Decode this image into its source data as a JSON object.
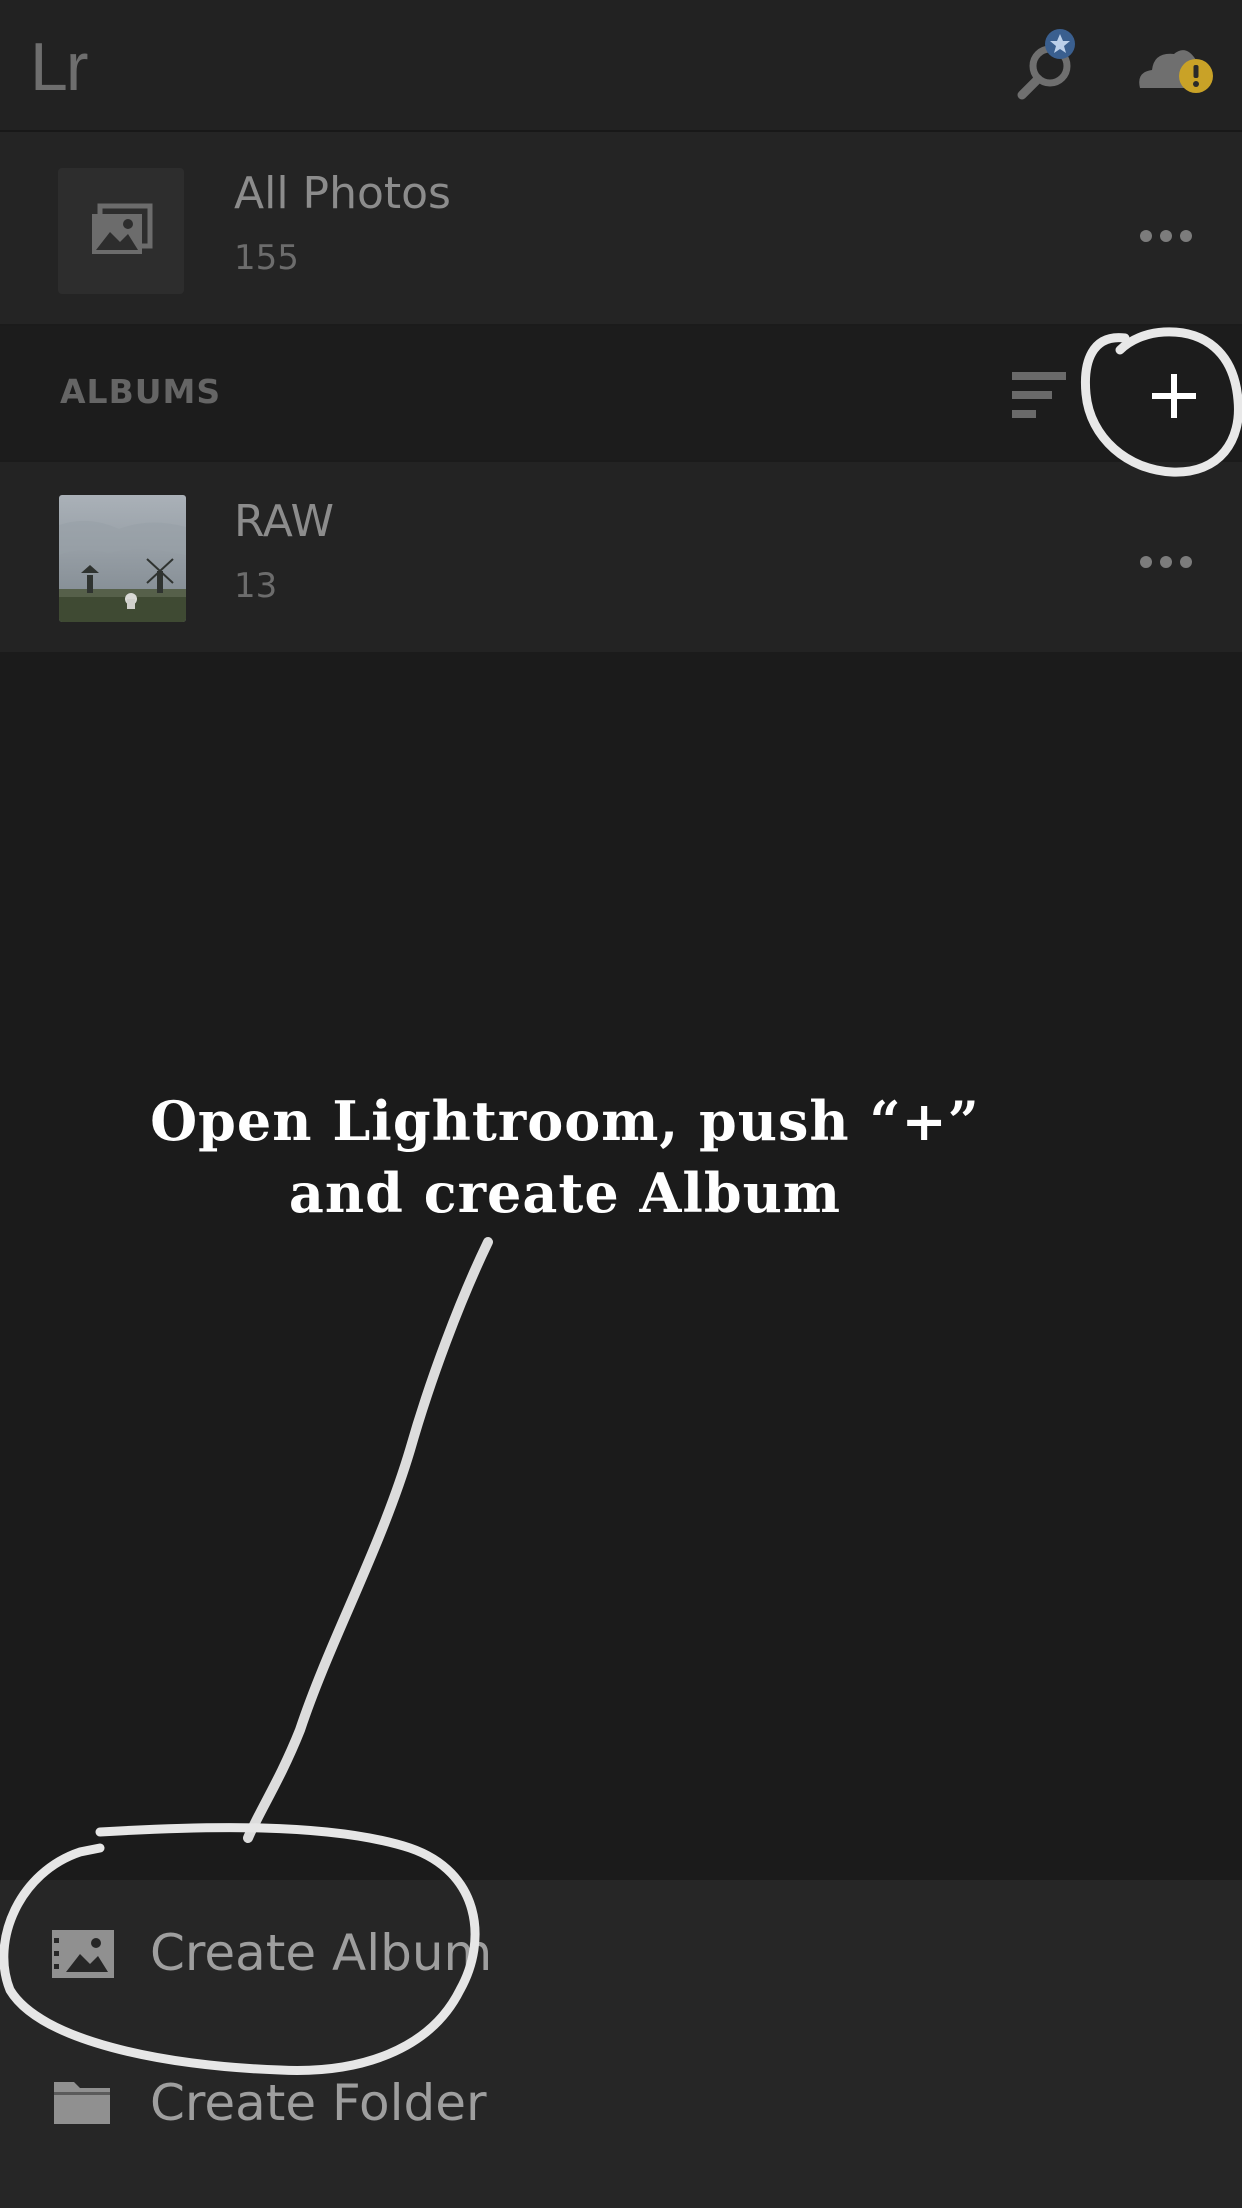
{
  "app": {
    "logo": "Lr"
  },
  "header": {
    "search_icon": "search-star-icon",
    "cloud_icon": "cloud-warning-icon",
    "accent_blue": "#3a5f8f",
    "warning_yellow": "#c9a227"
  },
  "all_photos": {
    "title": "All Photos",
    "count": "155"
  },
  "albums": {
    "section_label": "ALBUMS",
    "items": [
      {
        "title": "RAW",
        "count": "13"
      }
    ]
  },
  "annotation": {
    "line1": "Open Lightroom, push “+”",
    "line2": "and create Album"
  },
  "menu": {
    "items": [
      {
        "label": "Create Album",
        "icon": "album-icon"
      },
      {
        "label": "Create Folder",
        "icon": "folder-icon"
      }
    ]
  }
}
